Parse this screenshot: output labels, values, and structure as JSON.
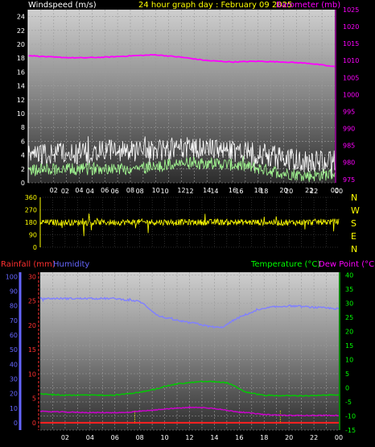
{
  "header": {
    "windspeed_label": "Windspeed (m/s)",
    "title": "24 hour graph day : February 09 2025",
    "barometer_label": "Barometer (mb)"
  },
  "bottom_header": {
    "rainfall_label": "Rainfall (mm)",
    "humidity_label": "Humidity",
    "temperature_label": "Temperature (°C)",
    "dewpoint_label": "Dew Point (°C)"
  },
  "compass_labels": [
    "N",
    "W",
    "S",
    "E",
    "N"
  ],
  "colors": {
    "windspeed": "#ffffff",
    "windspeed_avg": "#a6ff94",
    "barometer": "#ff00ff",
    "wind_direction": "#ffff00",
    "rainfall": "#ff2020",
    "humidity": "#8080ff",
    "temperature": "#00cc00",
    "dew_point": "#d000d0",
    "title": "#ffff00",
    "temperature_label": "#00ff00",
    "dewpoint_label": "#ff00ff",
    "humidity_axis": "#6666ff",
    "rain_axis": "#ff3030"
  },
  "chart_data": [
    {
      "type": "line",
      "title": "24 hour graph day : February 09 2025",
      "x_ticks": [
        "02",
        "04",
        "06",
        "08",
        "10",
        "12",
        "14",
        "16",
        "18",
        "20",
        "22",
        "00"
      ],
      "y_left": {
        "label": "Windspeed (m/s)",
        "ylim": [
          0,
          25
        ],
        "ticks": [
          0,
          2,
          4,
          6,
          8,
          10,
          12,
          14,
          16,
          18,
          20,
          22,
          24
        ]
      },
      "y_right": {
        "label": "Barometer (mb)",
        "ylim": [
          974,
          1025
        ],
        "ticks": [
          975,
          980,
          985,
          990,
          995,
          1000,
          1005,
          1010,
          1015,
          1020,
          1025
        ]
      },
      "series": [
        {
          "name": "Windspeed (m/s)",
          "axis": "left",
          "hours": [
            0,
            2,
            4,
            6,
            8,
            10,
            12,
            14,
            16,
            18,
            20,
            22,
            24
          ],
          "values": [
            3.8,
            4.2,
            4.3,
            4.8,
            4.5,
            4.8,
            5.0,
            5.0,
            4.5,
            4.2,
            3.5,
            3.0,
            3.2
          ]
        },
        {
          "axis": "left",
          "hours": [
            0,
            2,
            4,
            6,
            8,
            10,
            12,
            14,
            16,
            18,
            20,
            22,
            24
          ],
          "values": [
            1.8,
            2.0,
            1.9,
            2.2,
            2.0,
            2.4,
            2.8,
            2.9,
            2.6,
            2.1,
            1.4,
            1.0,
            1.3
          ]
        },
        {
          "name": "Barometer (mb)",
          "axis": "right",
          "hours": [
            0,
            2,
            4,
            6,
            8,
            10,
            12,
            14,
            16,
            18,
            20,
            22,
            24
          ],
          "values": [
            1011.5,
            1011.0,
            1010.8,
            1011.0,
            1011.4,
            1011.7,
            1011.0,
            1010.0,
            1009.6,
            1009.8,
            1009.6,
            1009.2,
            1008.2
          ]
        }
      ]
    },
    {
      "type": "line",
      "x_ticks": [
        "02",
        "04",
        "06",
        "08",
        "10",
        "12",
        "14",
        "16",
        "18",
        "20",
        "22",
        "00"
      ],
      "y_left": {
        "ylim": [
          0,
          360
        ],
        "ticks": [
          0,
          90,
          180,
          270,
          360
        ]
      },
      "y_right": {
        "labels": [
          "N",
          "W",
          "S",
          "E",
          "N"
        ]
      },
      "series": [
        {
          "axis": "left",
          "hours": [
            0,
            4,
            8,
            12,
            16,
            20,
            24
          ],
          "values": [
            180,
            178,
            182,
            180,
            181,
            178,
            185
          ]
        }
      ]
    },
    {
      "type": "line",
      "x_ticks": [
        "02",
        "04",
        "06",
        "08",
        "10",
        "12",
        "14",
        "16",
        "18",
        "20",
        "22",
        "00"
      ],
      "y_left_outer": {
        "label": "Humidity",
        "ylim": [
          -5,
          103
        ],
        "ticks": [
          0,
          10,
          20,
          30,
          40,
          50,
          60,
          70,
          80,
          90,
          100
        ]
      },
      "y_left_inner": {
        "label": "Rainfall (mm)",
        "ylim": [
          -1.5,
          30.9
        ],
        "ticks": [
          0,
          5,
          10,
          15,
          20,
          25,
          30
        ]
      },
      "y_right": {
        "label": "Temperature (°C) / Dew Point (°C)",
        "ylim": [
          -15,
          41
        ],
        "ticks": [
          -15,
          -10,
          -5,
          0,
          5,
          10,
          15,
          20,
          25,
          30,
          35,
          40
        ]
      },
      "series": [
        {
          "name": "Humidity",
          "axis": "left_outer",
          "hours": [
            0,
            2,
            4,
            6,
            7,
            8,
            8.5,
            9.5,
            10.5,
            11.5,
            12.5,
            13.5,
            14.5,
            15,
            15.5,
            16.5,
            17.5,
            18.5,
            20,
            22,
            24
          ],
          "values": [
            85,
            85,
            85,
            85,
            84,
            83,
            80,
            73,
            71,
            69,
            68,
            66,
            65,
            67,
            70,
            74,
            77,
            79,
            80,
            79,
            78
          ]
        },
        {
          "name": "Temperature (°C)",
          "axis": "right",
          "hours": [
            0,
            2,
            4,
            6,
            8,
            9,
            10,
            11,
            12,
            13,
            14,
            15,
            15.7,
            16.5,
            18,
            20,
            22,
            24
          ],
          "values": [
            -2.2,
            -2.6,
            -2.6,
            -2.6,
            -1.6,
            -0.8,
            0.5,
            1.4,
            1.8,
            2.2,
            2.2,
            1.8,
            0.4,
            -1.5,
            -2.7,
            -2.8,
            -2.8,
            -2.4
          ]
        },
        {
          "name": "Dew Point (°C)",
          "axis": "right",
          "hours": [
            0,
            2,
            4,
            6,
            7,
            8,
            9,
            10,
            11,
            12,
            13,
            14,
            15,
            16,
            17,
            18,
            20,
            22,
            24
          ],
          "values": [
            -8.4,
            -8.6,
            -8.8,
            -8.8,
            -8.8,
            -8.3,
            -8.0,
            -7.5,
            -7.2,
            -7.0,
            -7.0,
            -7.3,
            -8.0,
            -8.6,
            -9.0,
            -9.5,
            -9.8,
            -9.8,
            -9.8
          ]
        },
        {
          "name": "Rainfall (mm)",
          "axis": "left_inner",
          "hours": [
            0,
            24
          ],
          "values": [
            0,
            0
          ]
        }
      ]
    }
  ]
}
